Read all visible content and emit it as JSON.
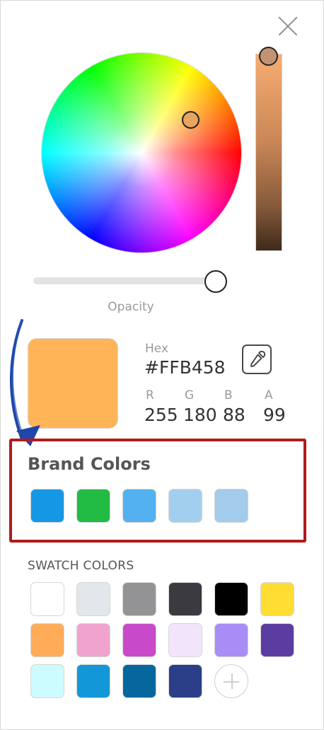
{
  "colors": {
    "current": "#FFB458",
    "annotation_box": "#b21a1a",
    "annotation_arrow": "#1f46a8"
  },
  "close": {
    "icon": "close-icon"
  },
  "opacity": {
    "label": "Opacity",
    "value": 99
  },
  "color": {
    "hex_label": "Hex",
    "hex": "#FFB458",
    "eyedropper_icon": "eyedropper-icon",
    "channels": [
      {
        "label": "R",
        "value": "255"
      },
      {
        "label": "G",
        "value": "180"
      },
      {
        "label": "B",
        "value": "88"
      },
      {
        "label": "A",
        "value": "99"
      }
    ]
  },
  "brand": {
    "title": "Brand Colors",
    "swatches": [
      "#1597e5",
      "#22bb44",
      "#53b1ef",
      "#a3cfee",
      "#a3cbec"
    ]
  },
  "swatch_colors": {
    "title": "SWATCH COLORS",
    "swatches": [
      "#ffffff",
      "#e2e7eb",
      "#939395",
      "#3a3a40",
      "#000000",
      "#ffdd33",
      "#ffac58",
      "#f0a3cf",
      "#c84ac8",
      "#f2e5fb",
      "#a98cf6",
      "#5b3da2",
      "#cdfbff",
      "#1298d8",
      "#06679f",
      "#2b3f88"
    ],
    "add_icon": "plus-icon"
  }
}
